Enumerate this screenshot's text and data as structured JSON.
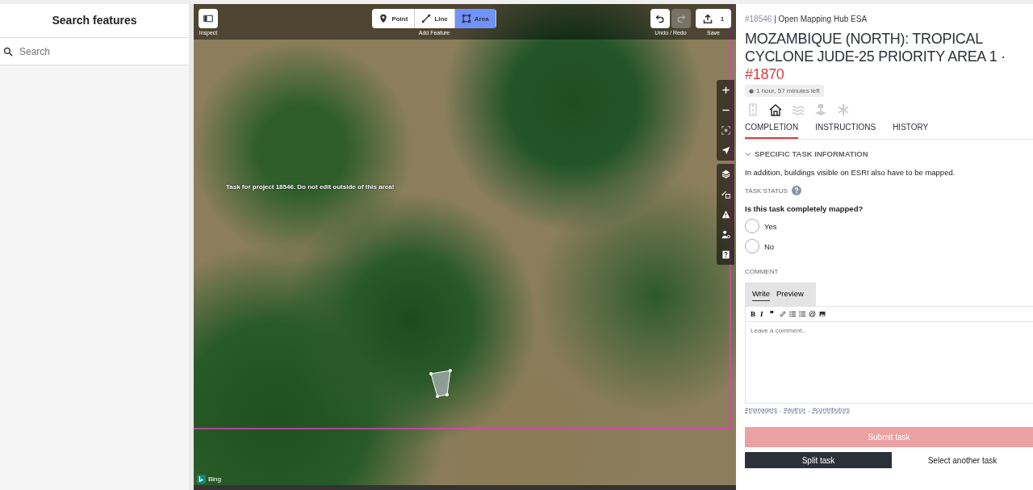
{
  "sidebar": {
    "title": "Search features",
    "search": {
      "placeholder": "Search"
    }
  },
  "map": {
    "inspect": {
      "label": "Inspect"
    },
    "add_feature": {
      "label": "Add Feature",
      "modes": [
        {
          "kind": "point",
          "label": "Point",
          "selected": false
        },
        {
          "kind": "line",
          "label": "Line",
          "selected": false
        },
        {
          "kind": "area",
          "label": "Area",
          "selected": true
        }
      ]
    },
    "undo_redo": {
      "label": "Undo / Redo",
      "undo_disabled": false,
      "redo_disabled": true
    },
    "save": {
      "label": "Save",
      "count": "1"
    },
    "notice": "Task for project 18546. Do not edit outside of this area!",
    "attribution": "Bing"
  },
  "panel": {
    "project_id": "#18546",
    "separator": "|",
    "organisation": "Open Mapping Hub ESA",
    "title": "MOZAMBIQUE (NORTH): TROPICAL CYCLONE JUDE-25 PRIORITY AREA 1 ·",
    "task_id": "#1870",
    "time_left": "1 hour, 57 minutes left",
    "feature_icons": [
      {
        "kind": "road",
        "active": false
      },
      {
        "kind": "building",
        "active": true
      },
      {
        "kind": "waterway",
        "active": false
      },
      {
        "kind": "landuse",
        "active": false
      },
      {
        "kind": "other",
        "active": false
      }
    ],
    "tabs": [
      {
        "label": "COMPLETION",
        "selected": true
      },
      {
        "label": "INSTRUCTIONS",
        "selected": false
      },
      {
        "label": "HISTORY",
        "selected": false
      }
    ],
    "section": {
      "title": "SPECIFIC TASK INFORMATION",
      "expanded": true
    },
    "info": "In addition, buildings visible on ESRI also have to be mapped.",
    "status_label": "TASK STATUS",
    "question": "Is this task completely mapped?",
    "options": [
      {
        "label": "Yes",
        "selected": false
      },
      {
        "label": "No",
        "selected": false
      }
    ],
    "comment_label": "COMMENT",
    "editor_tabs": [
      {
        "label": "Write",
        "selected": true
      },
      {
        "label": "Preview",
        "selected": false
      }
    ],
    "editor_tools": [
      {
        "kind": "bold",
        "glyph": "B"
      },
      {
        "kind": "italic",
        "glyph": "I"
      },
      {
        "kind": "quote",
        "glyph": "❞"
      },
      {
        "kind": "link"
      },
      {
        "kind": "bullet_list"
      },
      {
        "kind": "numbered_list"
      },
      {
        "kind": "mention",
        "glyph": "@"
      },
      {
        "kind": "image"
      }
    ],
    "comment": {
      "placeholder": "Leave a comment..."
    },
    "mentions": [
      "#managers",
      "#author",
      "#contributors"
    ],
    "mention_separator": ",",
    "submit": {
      "label": "Submit task",
      "disabled": true
    },
    "split": {
      "label": "Split task"
    },
    "select_another": {
      "label": "Select another task"
    }
  }
}
